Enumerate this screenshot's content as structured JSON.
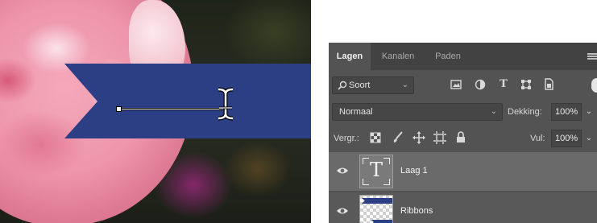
{
  "colors": {
    "ribbon": "#2c3f84",
    "panel_bg": "#535353",
    "tab_bar_bg": "#424242",
    "selected_layer_bg": "#6a6a6a"
  },
  "layers_panel": {
    "tabs": [
      {
        "label": "Lagen",
        "active": true
      },
      {
        "label": "Kanalen",
        "active": false
      },
      {
        "label": "Paden",
        "active": false
      }
    ],
    "filter": {
      "label": "Soort",
      "icons": [
        "image-filter-icon",
        "adjustment-filter-icon",
        "type-filter-icon",
        "shape-filter-icon",
        "smart-object-filter-icon"
      ]
    },
    "blend_mode": "Normaal",
    "opacity": {
      "label": "Dekking:",
      "value": "100%"
    },
    "lock": {
      "label": "Vergr.:",
      "icons": [
        "lock-transparency-icon",
        "lock-image-icon",
        "lock-position-icon",
        "lock-artboard-icon",
        "lock-all-icon"
      ]
    },
    "fill": {
      "label": "Vul:",
      "value": "100%"
    },
    "layers": [
      {
        "name": "Laag 1",
        "kind": "text",
        "thumb_glyph": "T",
        "visible": true,
        "selected": true
      },
      {
        "name": "Ribbons",
        "kind": "image",
        "visible": true,
        "selected": false
      }
    ]
  }
}
